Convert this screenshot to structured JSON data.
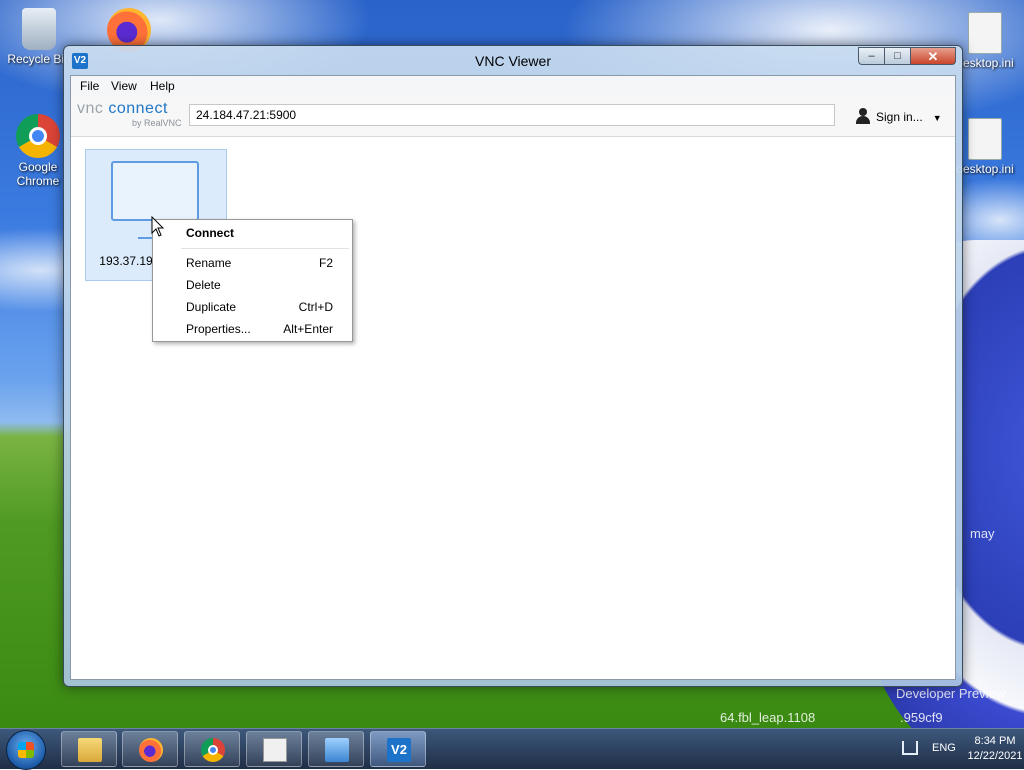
{
  "desktop": {
    "icons": [
      {
        "label": "Recycle Bin"
      },
      {
        "label": "Google Chrome"
      },
      {
        "label": "desktop.ini"
      },
      {
        "label": "desktop.ini"
      }
    ],
    "watermark_line1": "Developer Preview",
    "watermark_line2": "64.fbl_leap.1108",
    "watermark_line3": ".959cf9",
    "side_text": "may"
  },
  "window": {
    "title": "VNC Viewer",
    "icon_text": "V2",
    "minimize_glyph": "‒",
    "maximize_glyph": "□",
    "close_glyph": "✕"
  },
  "menu": {
    "file": "File",
    "view": "View",
    "help": "Help"
  },
  "toolbar": {
    "logo_text_vnc": "vnc",
    "logo_text_connect": "connect",
    "logo_sub": "by RealVNC",
    "address_value": "24.184.47.21:5900",
    "sign_in": "Sign in...",
    "caret": "▼"
  },
  "address_book": {
    "entry_label": "193.37.19"
  },
  "context_menu": {
    "items": [
      {
        "label": "Connect",
        "shortcut": ""
      },
      {
        "label": "Rename",
        "shortcut": "F2"
      },
      {
        "label": "Delete",
        "shortcut": ""
      },
      {
        "label": "Duplicate",
        "shortcut": "Ctrl+D"
      },
      {
        "label": "Properties...",
        "shortcut": "Alt+Enter"
      }
    ]
  },
  "taskbar": {
    "language": "ENG",
    "time": "8:34 PM",
    "date": "12/22/2021",
    "vnc_text": "V2"
  }
}
